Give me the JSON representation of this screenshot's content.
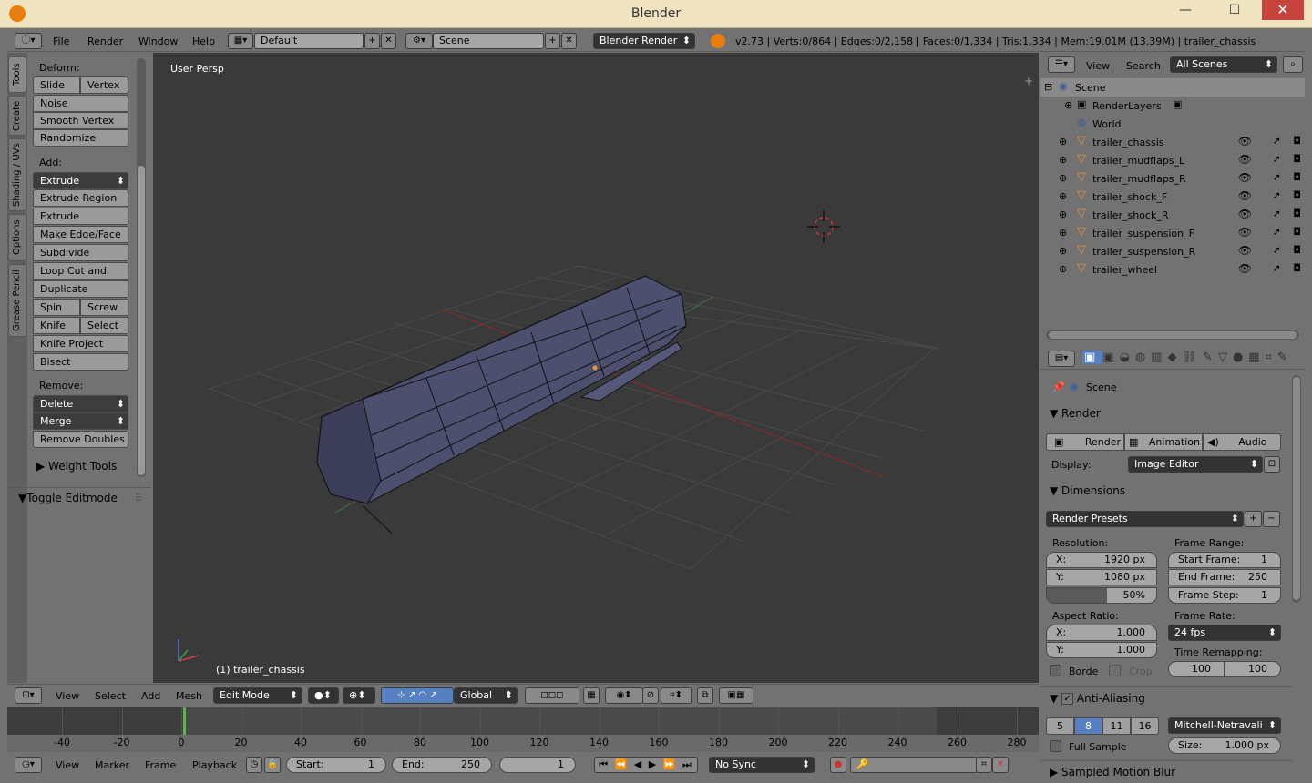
{
  "window": {
    "title": "Blender",
    "min": "—",
    "max": "☐",
    "close": "✕"
  },
  "topbar": {
    "menus": [
      "File",
      "Render",
      "Window",
      "Help"
    ],
    "layout": "Default",
    "scene": "Scene",
    "engine": "Blender Render",
    "stats": "v2.73 | Verts:0/864 | Edges:0/2,158 | Faces:0/1,334 | Tris:1,334 | Mem:19.01M (13.39M) | trailer_chassis"
  },
  "tabs": [
    "Tools",
    "Create",
    "Shading / UVs",
    "Options",
    "Grease Pencil"
  ],
  "toolshelf": {
    "deform_label": "Deform:",
    "slide_edge": "Slide Ed",
    "vertex": "Vertex",
    "noise": "Noise",
    "smooth_vertex": "Smooth Vertex",
    "randomize": "Randomize",
    "add_label": "Add:",
    "extrude": "Extrude",
    "extrude_region": "Extrude Region",
    "extrude_individual": "Extrude Individual",
    "make_edge_face": "Make Edge/Face",
    "subdivide": "Subdivide",
    "loop_cut": "Loop Cut and Slide",
    "duplicate": "Duplicate",
    "spin": "Spin",
    "screw": "Screw",
    "knife": "Knife",
    "select": "Select",
    "knife_project": "Knife Project",
    "bisect": "Bisect",
    "remove_label": "Remove:",
    "delete": "Delete",
    "merge": "Merge",
    "remove_doubles": "Remove Doubles",
    "weight_tools": "Weight Tools",
    "toggle_editmode": "Toggle Editmode"
  },
  "viewport": {
    "view_label": "User Persp",
    "object_label": "(1) trailer_chassis"
  },
  "outliner": {
    "view": "View",
    "search": "Search",
    "filter": "All Scenes",
    "scene": "Scene",
    "renderlayers": "RenderLayers",
    "world": "World",
    "objects": [
      "trailer_chassis",
      "trailer_mudflaps_L",
      "trailer_mudflaps_R",
      "trailer_shock_F",
      "trailer_shock_R",
      "trailer_suspension_F",
      "trailer_suspension_R",
      "trailer_wheel"
    ]
  },
  "properties": {
    "context": "Scene",
    "render_title": "Render",
    "render_btn": "Render",
    "animation_btn": "Animation",
    "audio_btn": "Audio",
    "display_label": "Display:",
    "display_value": "Image Editor",
    "dimensions_title": "Dimensions",
    "presets": "Render Presets",
    "resolution_label": "Resolution:",
    "res_x_label": "X:",
    "res_x": "1920 px",
    "res_y_label": "Y:",
    "res_y": "1080 px",
    "res_pct": "50%",
    "frame_range_label": "Frame Range:",
    "start_frame_label": "Start Frame:",
    "start_frame": "1",
    "end_frame_label": "End Frame:",
    "end_frame": "250",
    "frame_step_label": "Frame Step:",
    "frame_step": "1",
    "aspect_label": "Aspect Ratio:",
    "asp_x_label": "X:",
    "asp_x": "1.000",
    "asp_y_label": "Y:",
    "asp_y": "1.000",
    "frame_rate_label": "Frame Rate:",
    "fps": "24 fps",
    "time_remap_label": "Time Remapping:",
    "remap_old": "100",
    "remap_new": "100",
    "border": "Borde",
    "crop": "Crop",
    "aa_title": "Anti-Aliasing",
    "aa_samples": [
      "5",
      "8",
      "11",
      "16"
    ],
    "aa_filter": "Mitchell-Netravali",
    "full_sample": "Full Sample",
    "size_label": "Size:",
    "size": "1.000 px",
    "mblur_title": "Sampled Motion Blur"
  },
  "vpheader": {
    "menus": [
      "View",
      "Select",
      "Add",
      "Mesh"
    ],
    "mode": "Edit Mode",
    "orientation": "Global"
  },
  "timeline": {
    "ticks": [
      "-40",
      "-20",
      "0",
      "20",
      "40",
      "60",
      "80",
      "100",
      "120",
      "140",
      "160",
      "180",
      "200",
      "220",
      "240",
      "260",
      "280"
    ],
    "menus": [
      "View",
      "Marker",
      "Frame",
      "Playback"
    ],
    "start_label": "Start:",
    "start": "1",
    "end_label": "End:",
    "end": "250",
    "current": "1",
    "sync": "No Sync"
  },
  "colors": {
    "accent": "#5680c2",
    "selected_text": "#ffffff",
    "object_orange": "#e8972c"
  }
}
